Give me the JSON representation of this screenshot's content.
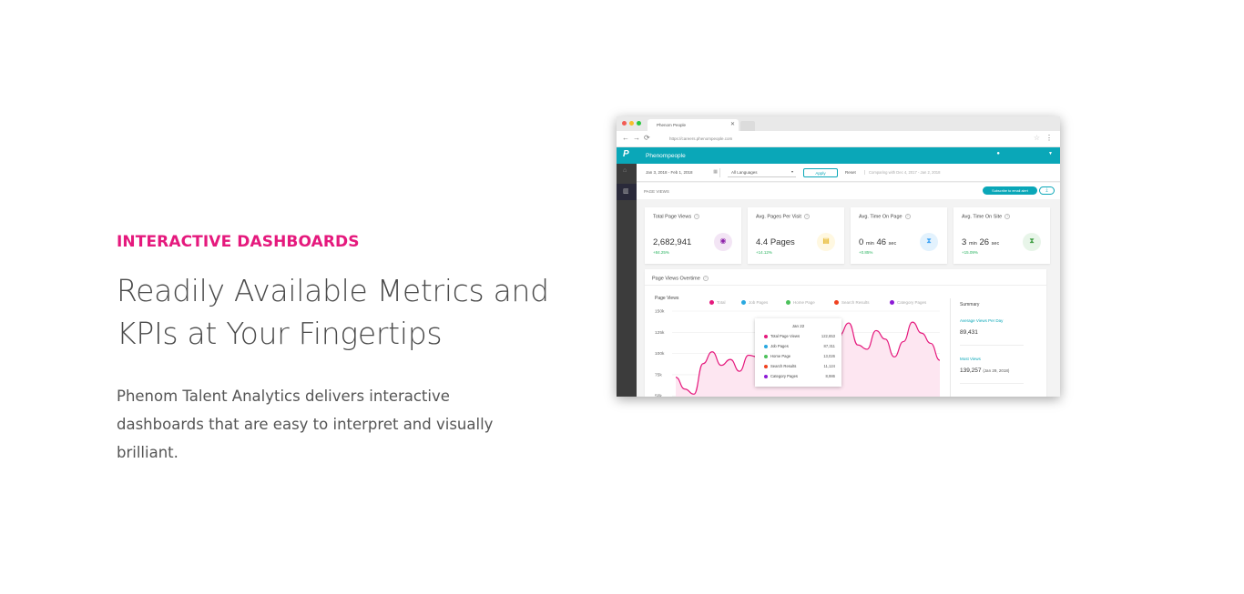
{
  "hero": {
    "eyebrow": "INTERACTIVE DASHBOARDS",
    "headline_line1": "Readily Available Metrics and",
    "headline_line2": "KPIs at Your Fingertips",
    "body_line1": "Phenom Talent Analytics delivers interactive",
    "body_line2": "dashboards that are easy to interpret and visually",
    "body_line3": "brilliant."
  },
  "browser": {
    "tab_title": "Phenom People",
    "url": "https://careers.phenompeople.com",
    "app_name": "Phenompeople"
  },
  "filters": {
    "date_range": "Jan 3, 2018 - Feb 1, 2018",
    "language": "All Languages",
    "apply_label": "Apply",
    "reset_label": "Reset",
    "comparing": "Comparing with Dec 4, 2017 - Jan 2, 2018"
  },
  "section": {
    "label": "PAGE VIEWS",
    "subscribe_label": "Subscribe to email alert"
  },
  "kpis": [
    {
      "title": "Total Page Views",
      "value": "2,682,941",
      "change": "+84.25%",
      "icon": "eye-icon",
      "icon_color": "#8e24aa",
      "icon_bg": "#f3e5f5"
    },
    {
      "title": "Avg. Pages Per Visit",
      "value": "4.4 Pages",
      "change": "+14.12%",
      "icon": "document-icon",
      "icon_color": "#e0a800",
      "icon_bg": "#fff8e1"
    },
    {
      "title": "Avg. Time On Page",
      "value_main": "0",
      "value_unit1": "min",
      "value_sec": "46",
      "value_unit2": "sec",
      "change": "+0.85%",
      "icon": "hourglass-icon",
      "icon_color": "#42a5f5",
      "icon_bg": "#e3f2fd"
    },
    {
      "title": "Avg. Time On Site",
      "value_main": "3",
      "value_unit1": "min",
      "value_sec": "26",
      "value_unit2": "sec",
      "change": "+15.09%",
      "icon": "hourglass-icon",
      "icon_color": "#43a047",
      "icon_bg": "#e8f5e9"
    }
  ],
  "chart_card": {
    "title": "Page Views Overtime",
    "y_title": "Page Views",
    "legend": [
      {
        "name": "Total",
        "color": "#e5197d"
      },
      {
        "name": "Job Pages",
        "color": "#29a8e0"
      },
      {
        "name": "Home Page",
        "color": "#4cc15b"
      },
      {
        "name": "Search Results",
        "color": "#f0411f"
      },
      {
        "name": "Category Pages",
        "color": "#8c1ad6"
      }
    ]
  },
  "chart_data": {
    "type": "area",
    "yticks": [
      "150k",
      "125k",
      "100k",
      "75k",
      "50k"
    ],
    "ylim": [
      50000,
      150000
    ],
    "series": [
      {
        "name": "Total",
        "values": [
          72000,
          58000,
          52000,
          88000,
          102000,
          86000,
          93000,
          79000,
          98000,
          96000,
          104000,
          83000,
          80000,
          103000,
          96000,
          104000,
          84000,
          90000,
          122000,
          136000,
          110000,
          105000,
          127000,
          117000,
          96000,
          114000,
          137000,
          124000,
          112000,
          92000
        ]
      }
    ]
  },
  "tooltip": {
    "date": "Jan 22",
    "rows": [
      {
        "label": "Total Page Views",
        "value": "122,653",
        "color": "#e5197d"
      },
      {
        "label": "Job Pages",
        "value": "87,311",
        "color": "#29a8e0"
      },
      {
        "label": "Home Page",
        "value": "13,026",
        "color": "#4cc15b"
      },
      {
        "label": "Search Results",
        "value": "11,124",
        "color": "#f0411f"
      },
      {
        "label": "Category Pages",
        "value": "8,986",
        "color": "#8c1ad6"
      }
    ]
  },
  "summary": {
    "title": "Summary",
    "avg_label": "Average Views Per Day",
    "avg_value": "89,431",
    "most_label": "Most Views",
    "most_value": "139,257",
    "most_date": "(Jan 29, 2018)"
  }
}
